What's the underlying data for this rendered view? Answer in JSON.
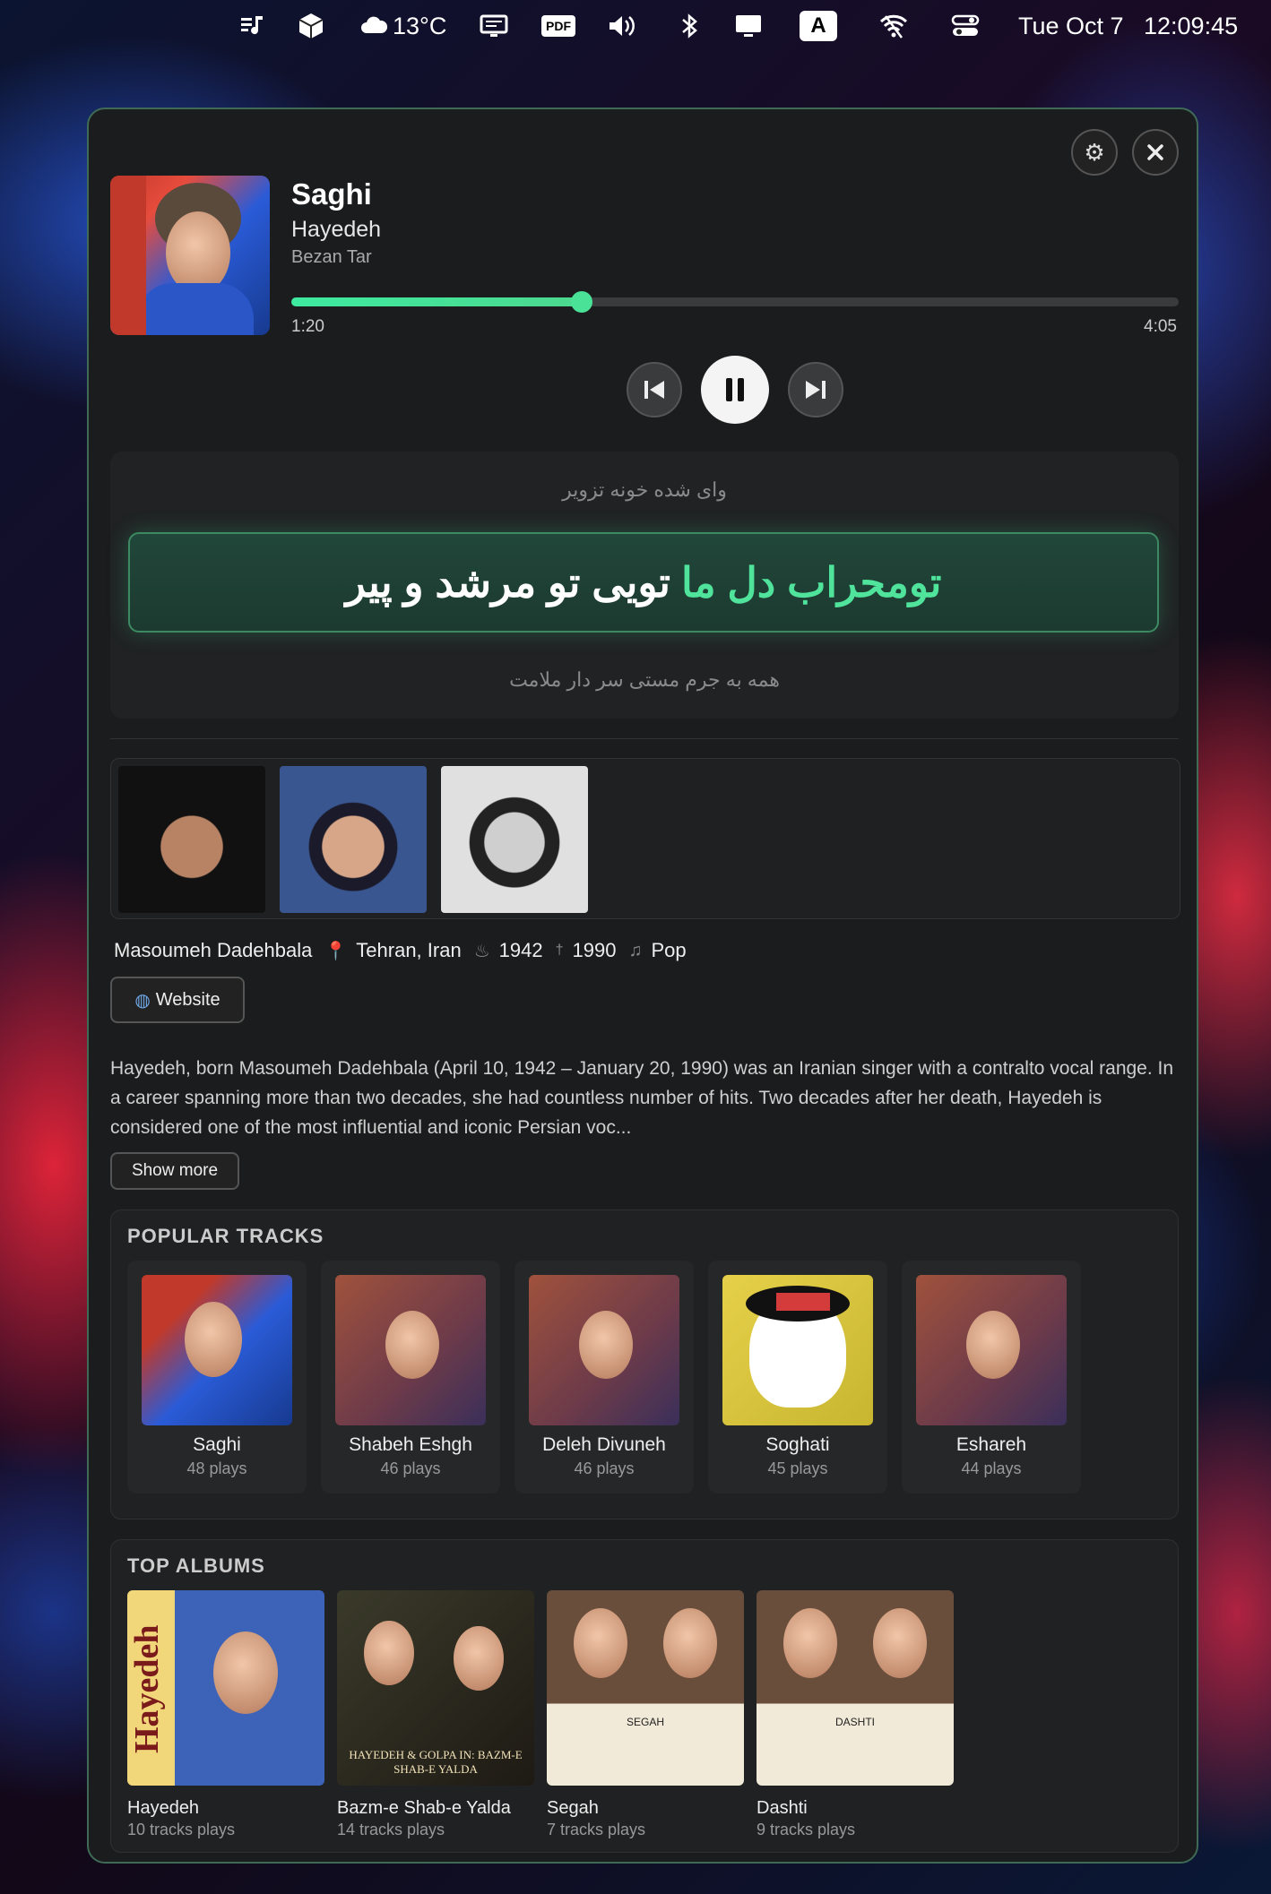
{
  "menubar": {
    "weather": "13°C",
    "date": "Tue Oct 7",
    "time": "12:09:45",
    "pdf_label": "PDF",
    "input_label": "A"
  },
  "now_playing": {
    "title": "Saghi",
    "artist": "Hayedeh",
    "album": "Bezan Tar",
    "elapsed": "1:20",
    "duration": "4:05",
    "progress": 0.327,
    "accent": "#4fe39b"
  },
  "lyrics": {
    "previous": "وای شده خونه تزویر",
    "current_highlight": "تومحراب دل ما",
    "current_rest": "تویی تو مرشد و پیر",
    "next": "همه به جرم مستی سر دار ملامت"
  },
  "artist_info": {
    "real_name": "Masoumeh Dadehbala",
    "location": "Tehran, Iran",
    "born": "1942",
    "died": "1990",
    "genre": "Pop",
    "website_label": "Website",
    "bio": "Hayedeh, born Masoumeh Dadehbala (April 10, 1942 – January 20, 1990) was an Iranian singer with a contralto vocal range. In a career spanning more than two decades, she had countless number of hits. Two decades after her death, Hayedeh is considered one of the most influential and iconic Persian voc...",
    "show_more_label": "Show more"
  },
  "popular_tracks": {
    "heading": "POPULAR TRACKS",
    "items": [
      {
        "name": "Saghi",
        "plays": "48 plays"
      },
      {
        "name": "Shabeh Eshgh",
        "plays": "46 plays"
      },
      {
        "name": "Deleh Divuneh",
        "plays": "46 plays"
      },
      {
        "name": "Soghati",
        "plays": "45 plays"
      },
      {
        "name": "Eshareh",
        "plays": "44 plays"
      }
    ]
  },
  "top_albums": {
    "heading": "TOP ALBUMS",
    "items": [
      {
        "name": "Hayedeh",
        "tracks": "10 tracks plays",
        "cover_text": "Hayedeh"
      },
      {
        "name": "Bazm-e Shab-e Yalda",
        "tracks": "14 tracks plays",
        "cover_text": "HAYEDEH & GOLPA IN: BAZM-E SHAB-E YALDA"
      },
      {
        "name": "Segah",
        "tracks": "7 tracks plays",
        "cover_text": "SEGAH"
      },
      {
        "name": "Dashti",
        "tracks": "9 tracks plays",
        "cover_text": "DASHTI"
      }
    ]
  }
}
